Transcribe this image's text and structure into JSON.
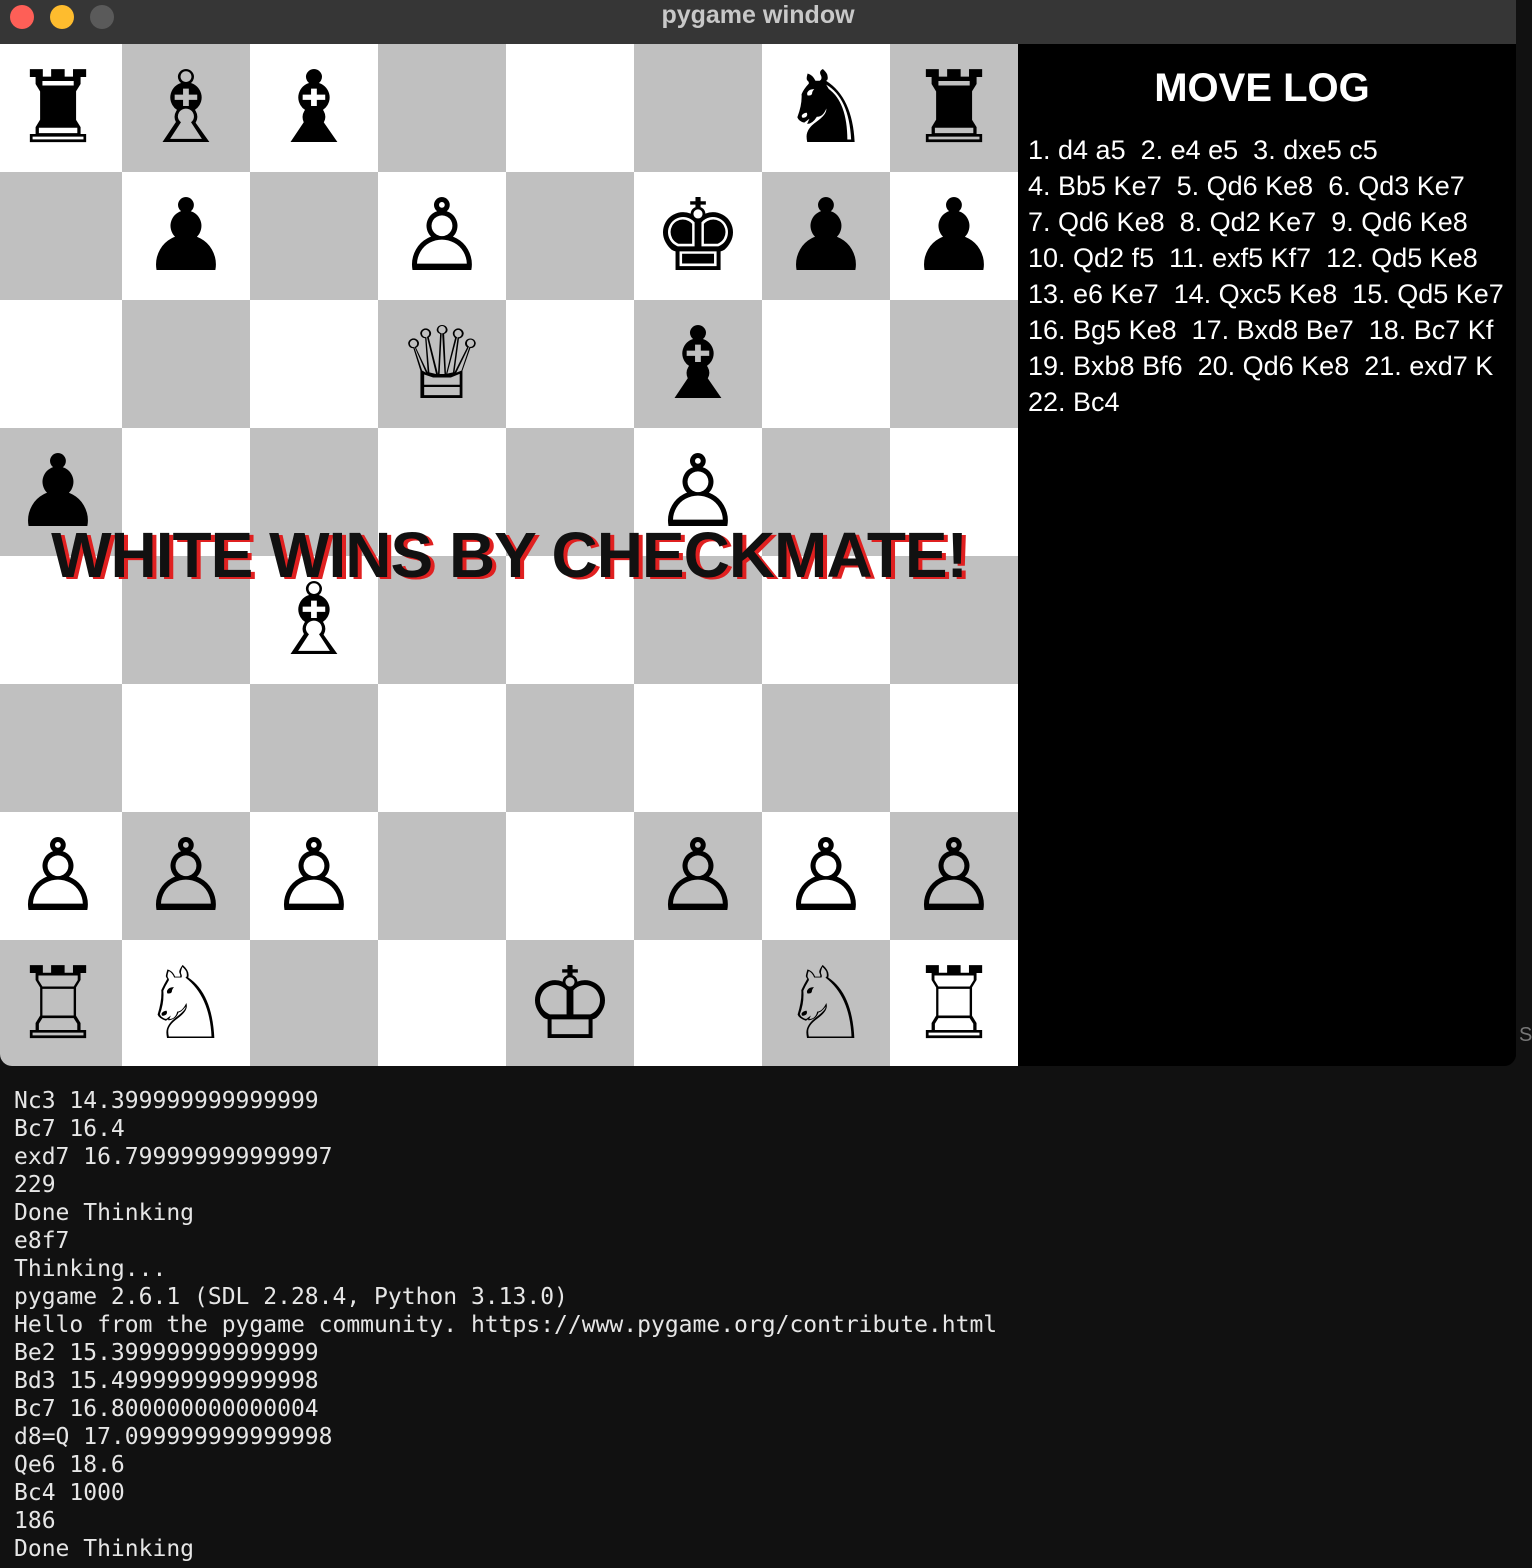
{
  "window": {
    "title": "pygame window"
  },
  "board": {
    "pieces": [
      [
        "♜",
        "♗",
        "♝",
        "",
        "",
        "",
        "♞",
        "♜"
      ],
      [
        "",
        "♟",
        "",
        "♙",
        "",
        "♚",
        "♟",
        "♟"
      ],
      [
        "",
        "",
        "",
        "♕",
        "",
        "♝",
        "",
        ""
      ],
      [
        "♟",
        "",
        "",
        "",
        "",
        "♙",
        "",
        ""
      ],
      [
        "",
        "",
        "♗",
        "",
        "",
        "",
        "",
        ""
      ],
      [
        "",
        "",
        "",
        "",
        "",
        "",
        "",
        ""
      ],
      [
        "♙",
        "♙",
        "♙",
        "",
        "",
        "♙",
        "♙",
        "♙"
      ],
      [
        "♖",
        "♘",
        "",
        "",
        "♔",
        "",
        "♘",
        "♖"
      ]
    ],
    "light_color": "#ffffff",
    "dark_color": "#c0c0c0"
  },
  "overlay": {
    "message": "WHITE WINS BY CHECKMATE!"
  },
  "move_log": {
    "title": "MOVE LOG",
    "lines": [
      "1. d4 a5  2. e4 e5  3. dxe5 c5",
      "4. Bb5 Ke7  5. Qd6 Ke8  6. Qd3 Ke7",
      "7. Qd6 Ke8  8. Qd2 Ke7  9. Qd6 Ke8",
      "10. Qd2 f5  11. exf5 Kf7  12. Qd5 Ke8",
      "13. e6 Ke7  14. Qxc5 Ke8  15. Qd5 Ke7",
      "16. Bg5 Ke8  17. Bxd8 Be7  18. Bc7 Kf",
      "19. Bxb8 Bf6  20. Qd6 Ke8  21. exd7 K",
      "22. Bc4"
    ]
  },
  "terminal": {
    "lines": [
      "Nc3 14.399999999999999",
      "Bc7 16.4",
      "exd7 16.799999999999997",
      "229",
      "Done Thinking",
      "e8f7",
      "Thinking...",
      "pygame 2.6.1 (SDL 2.28.4, Python 3.13.0)",
      "Hello from the pygame community. https://www.pygame.org/contribute.html",
      "Be2 15.399999999999999",
      "Bd3 15.499999999999998",
      "Bc7 16.800000000000004",
      "d8=Q 17.099999999999998",
      "Qe6 18.6",
      "Bc4 1000",
      "186",
      "Done Thinking"
    ]
  },
  "side_text": "S"
}
